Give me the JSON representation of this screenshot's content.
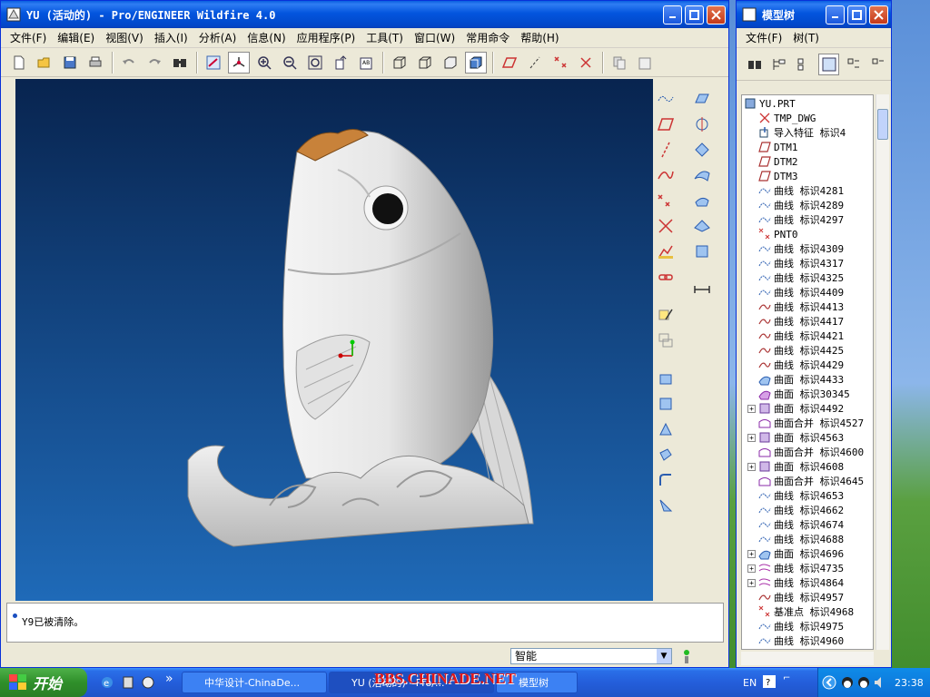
{
  "main_window": {
    "title": "YU (活动的) - Pro/ENGINEER Wildfire 4.0",
    "menu": [
      "文件(F)",
      "编辑(E)",
      "视图(V)",
      "插入(I)",
      "分析(A)",
      "信息(N)",
      "应用程序(P)",
      "工具(T)",
      "窗口(W)",
      "常用命令",
      "帮助(H)"
    ],
    "message": "Y9已被清除。",
    "filter": "智能"
  },
  "tree_window": {
    "title": "模型树",
    "menu": [
      "文件(F)",
      "树(T)"
    ],
    "items": [
      {
        "label": "YU.PRT",
        "icon": "part",
        "indent": 0,
        "exp": false
      },
      {
        "label": "TMP_DWG",
        "icon": "csys",
        "indent": 1,
        "exp": false
      },
      {
        "label": "导入特征 标识4",
        "icon": "import",
        "indent": 1,
        "exp": false
      },
      {
        "label": "DTM1",
        "icon": "plane",
        "indent": 1,
        "exp": false
      },
      {
        "label": "DTM2",
        "icon": "plane",
        "indent": 1,
        "exp": false
      },
      {
        "label": "DTM3",
        "icon": "plane",
        "indent": 1,
        "exp": false
      },
      {
        "label": "曲线 标识4281",
        "icon": "curve-dash",
        "indent": 1,
        "exp": false
      },
      {
        "label": "曲线 标识4289",
        "icon": "curve-dash",
        "indent": 1,
        "exp": false
      },
      {
        "label": "曲线 标识4297",
        "icon": "curve-dash",
        "indent": 1,
        "exp": false
      },
      {
        "label": "PNT0",
        "icon": "point",
        "indent": 1,
        "exp": false
      },
      {
        "label": "曲线 标识4309",
        "icon": "curve-dash",
        "indent": 1,
        "exp": false
      },
      {
        "label": "曲线 标识4317",
        "icon": "curve-dash",
        "indent": 1,
        "exp": false
      },
      {
        "label": "曲线 标识4325",
        "icon": "curve-dash",
        "indent": 1,
        "exp": false
      },
      {
        "label": "曲线 标识4409",
        "icon": "curve-dash",
        "indent": 1,
        "exp": false
      },
      {
        "label": "曲线 标识4413",
        "icon": "curve",
        "indent": 1,
        "exp": false
      },
      {
        "label": "曲线 标识4417",
        "icon": "curve",
        "indent": 1,
        "exp": false
      },
      {
        "label": "曲线 标识4421",
        "icon": "curve",
        "indent": 1,
        "exp": false
      },
      {
        "label": "曲线 标识4425",
        "icon": "curve",
        "indent": 1,
        "exp": false
      },
      {
        "label": "曲线 标识4429",
        "icon": "curve",
        "indent": 1,
        "exp": false
      },
      {
        "label": "曲面 标识4433",
        "icon": "surface-blue",
        "indent": 1,
        "exp": false
      },
      {
        "label": "曲面 标识30345",
        "icon": "surface-purple",
        "indent": 1,
        "exp": false
      },
      {
        "label": "曲面 标识4492",
        "icon": "surface-box",
        "indent": 1,
        "exp": true
      },
      {
        "label": "曲面合并 标识4527",
        "icon": "merge",
        "indent": 1,
        "exp": false
      },
      {
        "label": "曲面 标识4563",
        "icon": "surface-box",
        "indent": 1,
        "exp": true
      },
      {
        "label": "曲面合并 标识4600",
        "icon": "merge",
        "indent": 1,
        "exp": false
      },
      {
        "label": "曲面 标识4608",
        "icon": "surface-box",
        "indent": 1,
        "exp": true
      },
      {
        "label": "曲面合并 标识4645",
        "icon": "merge",
        "indent": 1,
        "exp": false
      },
      {
        "label": "曲线 标识4653",
        "icon": "curve-dash",
        "indent": 1,
        "exp": false
      },
      {
        "label": "曲线 标识4662",
        "icon": "curve-dash",
        "indent": 1,
        "exp": false
      },
      {
        "label": "曲线 标识4674",
        "icon": "curve-dash",
        "indent": 1,
        "exp": false
      },
      {
        "label": "曲线 标识4688",
        "icon": "curve-dash",
        "indent": 1,
        "exp": false
      },
      {
        "label": "曲面 标识4696",
        "icon": "surface-blue",
        "indent": 1,
        "exp": true
      },
      {
        "label": "曲线 标识4735",
        "icon": "curve-multi",
        "indent": 1,
        "exp": true
      },
      {
        "label": "曲线 标识4864",
        "icon": "curve-multi",
        "indent": 1,
        "exp": true
      },
      {
        "label": "曲线 标识4957",
        "icon": "curve",
        "indent": 1,
        "exp": false
      },
      {
        "label": "基准点 标识4968",
        "icon": "point",
        "indent": 1,
        "exp": false
      },
      {
        "label": "曲线 标识4975",
        "icon": "curve-dash",
        "indent": 1,
        "exp": false
      },
      {
        "label": "曲线 标识4960",
        "icon": "curve-dash",
        "indent": 1,
        "exp": false
      }
    ]
  },
  "taskbar": {
    "start": "开始",
    "tasks": [
      "中华设计-ChinaDe...",
      "YU (活动的) - Pro/...",
      "模型树"
    ],
    "watermark": "BBS.CHINADE.NET",
    "lang": "EN",
    "clock": "23:38"
  },
  "colors": {
    "title_blue": "#0355de",
    "viewport_top": "#08244f",
    "viewport_bottom": "#1f6ab8",
    "model_grey": "#e8e8e8",
    "watermark_red": "#e01818"
  }
}
